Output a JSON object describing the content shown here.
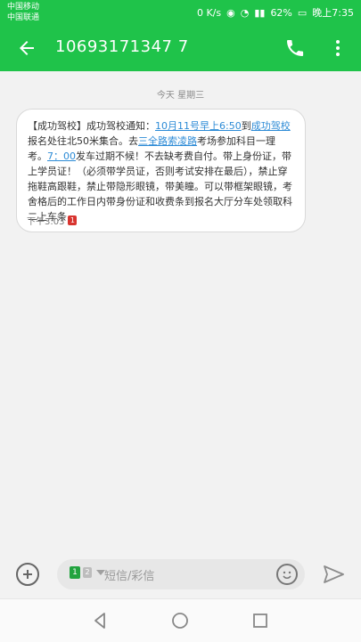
{
  "status": {
    "carrier_1": "中国移动",
    "carrier_2": "中国联通",
    "speed": "0 K/s",
    "battery": "62%",
    "time": "晚上7:35"
  },
  "header": {
    "phone_number": "10693171347 7"
  },
  "conversation": {
    "date_label": "今天 星期三",
    "message": {
      "part1": "【成功驾校】成功驾校通知：",
      "link1": "10月11号早上6:50",
      "part2": "到",
      "link2": "成功驾校",
      "part3": "报名处往北50米集合。去",
      "link3": "三全路索凌路",
      "part4": "考场参加科目一理考。",
      "link4": "7：00",
      "part5": "发车过期不候！不去缺考费自付。带上身份证，带上学员证！（必须带学员证，否则考试安排在最后），禁止穿拖鞋高跟鞋，禁止带隐形眼镜，带美瞳。可以带框架眼镜，考舍格后的工作日内带身份证和收费条到报名大厅分车处领取科二上车条",
      "time": "下午3:03",
      "sim_badge": "1"
    }
  },
  "composer": {
    "placeholder": "短信/彩信",
    "sim_primary": "1",
    "sim_secondary": "2"
  },
  "colors": {
    "accent": "#1fc34a",
    "link": "#2d8bd6"
  }
}
